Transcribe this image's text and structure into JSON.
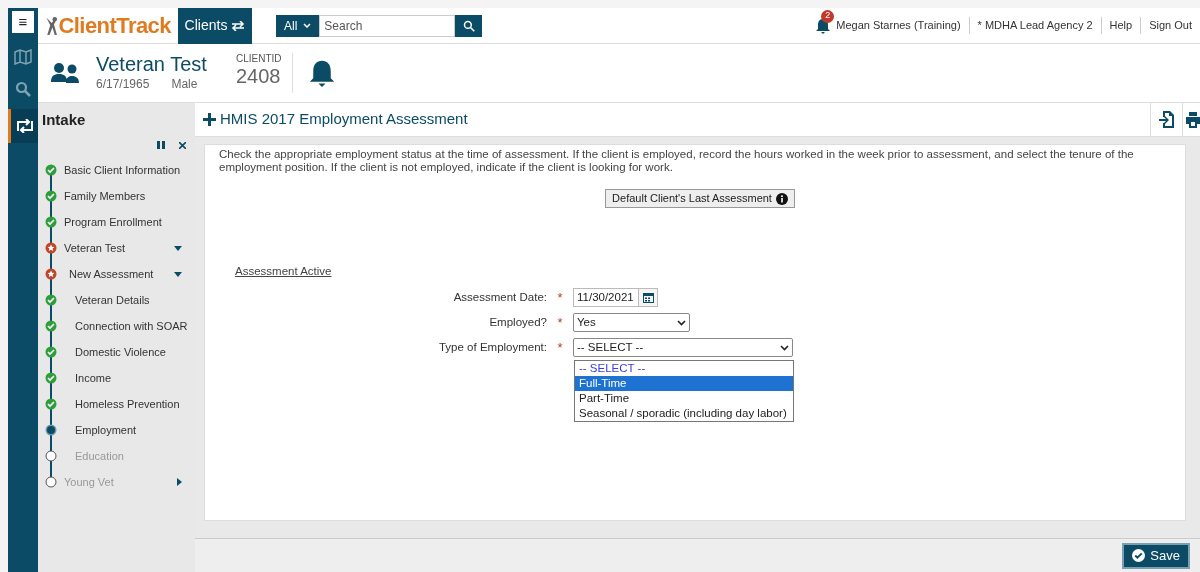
{
  "header": {
    "menu_button": "≡",
    "logo": "ClientTrack",
    "clients_tab": "Clients",
    "search_scope": "All",
    "search": {
      "placeholder": "Search"
    },
    "notifications_count": "2",
    "user": "Megan Starnes (Training)",
    "agency": "* MDHA Lead Agency 2",
    "links": [
      "Help",
      "Sign Out"
    ]
  },
  "client": {
    "name": "Veteran Test",
    "dob": "6/17/1965",
    "gender": "Male",
    "id_label": "CLIENTID",
    "id": "2408"
  },
  "sidebar": {
    "title": "Intake",
    "steps": [
      {
        "label": "Basic Client Information",
        "kind": "complete"
      },
      {
        "label": "Family Members",
        "kind": "complete"
      },
      {
        "label": "Program Enrollment",
        "kind": "complete"
      },
      {
        "label": "Veteran Test",
        "kind": "flagged",
        "expanded": true,
        "children": [
          {
            "label": "New Assessment",
            "kind": "flagged",
            "expanded": true,
            "children": [
              {
                "label": "Veteran Details",
                "kind": "complete"
              },
              {
                "label": "Connection with SOAR",
                "kind": "complete"
              },
              {
                "label": "Domestic Violence",
                "kind": "complete"
              },
              {
                "label": "Income",
                "kind": "complete"
              },
              {
                "label": "Homeless Prevention",
                "kind": "complete"
              },
              {
                "label": "Employment",
                "kind": "current"
              },
              {
                "label": "Education",
                "kind": "pending"
              }
            ]
          }
        ]
      },
      {
        "label": "Young Vet",
        "kind": "pending",
        "expanded": false
      }
    ]
  },
  "page": {
    "title": "HMIS 2017 Employment Assessment",
    "instructions": "Check the appropriate employment status at the time of assessment.  If the client is employed, record the hours worked in the week prior to assessment, and select the tenure of the employment position. If the client is not employed, indicate if the client is looking for work.",
    "default_button": "Default Client's Last Assessment",
    "section": "Assessment Active",
    "fields": [
      {
        "kind": "date",
        "label": "Assessment Date:",
        "required_mark": "*",
        "value": "11/30/2021"
      },
      {
        "kind": "select",
        "label": "Employed?",
        "required_mark": "*",
        "value": "Yes"
      },
      {
        "kind": "select",
        "label": "Type of Employment:",
        "required_mark": "*",
        "value": "-- SELECT --",
        "expanded": true,
        "options": [
          {
            "label": "-- SELECT --",
            "selected": true,
            "highlighted": false
          },
          {
            "label": "Full-Time",
            "selected": false,
            "highlighted": true
          },
          {
            "label": "Part-Time",
            "selected": false,
            "highlighted": false
          },
          {
            "label": "Seasonal / sporadic (including day labor)",
            "selected": false,
            "highlighted": false
          }
        ]
      }
    ]
  },
  "footer": {
    "save_button": "Save"
  }
}
